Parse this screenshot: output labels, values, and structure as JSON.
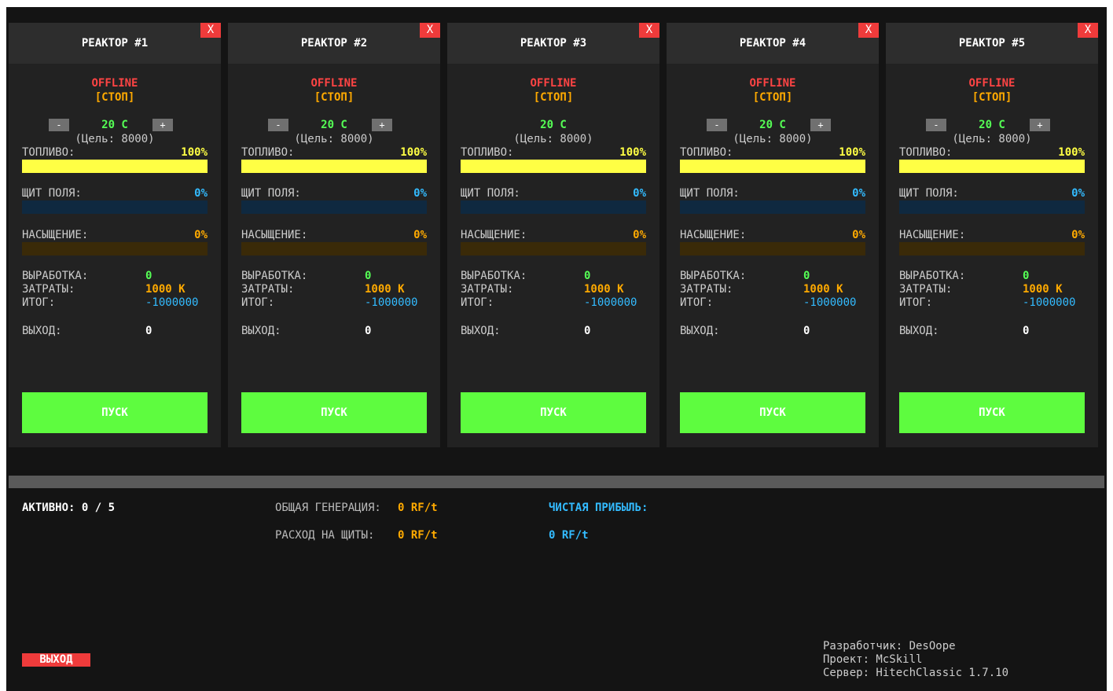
{
  "reactors": [
    {
      "title": "РЕАКТОР #1",
      "close": "X",
      "status": "OFFLINE",
      "state": "[СТОП]",
      "minus": "-",
      "temp": "20 C",
      "plus": "+",
      "target": "(Цель: 8000)",
      "fuel_label": "ТОПЛИВО:",
      "fuel_pct": "100%",
      "fuel_value": 1.0,
      "shield_label": "ЩИТ ПОЛЯ:",
      "shield_pct": "0%",
      "shield_value": 0,
      "sat_label": "НАСЫЩЕНИЕ:",
      "sat_pct": "0%",
      "sat_value": 0,
      "gen_label": "ВЫРАБОТКА:",
      "gen_value": "0",
      "cost_label": "ЗАТРАТЫ:",
      "cost_value": "1000 K",
      "total_label": "ИТОГ:",
      "total_value": "-1000000",
      "out_label": "ВЫХОД:",
      "out_value": "0",
      "start": "ПУСК"
    },
    {
      "title": "РЕАКТОР #2",
      "close": "X",
      "status": "OFFLINE",
      "state": "[СТОП]",
      "minus": "-",
      "temp": "20 C",
      "plus": "+",
      "target": "(Цель: 8000)",
      "fuel_label": "ТОПЛИВО:",
      "fuel_pct": "100%",
      "fuel_value": 1.0,
      "shield_label": "ЩИТ ПОЛЯ:",
      "shield_pct": "0%",
      "shield_value": 0,
      "sat_label": "НАСЫЩЕНИЕ:",
      "sat_pct": "0%",
      "sat_value": 0,
      "gen_label": "ВЫРАБОТКА:",
      "gen_value": "0",
      "cost_label": "ЗАТРАТЫ:",
      "cost_value": "1000 K",
      "total_label": "ИТОГ:",
      "total_value": "-1000000",
      "out_label": "ВЫХОД:",
      "out_value": "0",
      "start": "ПУСК"
    },
    {
      "title": "РЕАКТОР #3",
      "close": "X",
      "status": "OFFLINE",
      "state": "[СТОП]",
      "minus": "",
      "temp": "20 C",
      "plus": "",
      "target": "(Цель: 8000)",
      "fuel_label": "ТОПЛИВО:",
      "fuel_pct": "100%",
      "fuel_value": 1.0,
      "shield_label": "ЩИТ ПОЛЯ:",
      "shield_pct": "0%",
      "shield_value": 0,
      "sat_label": "НАСЫЩЕНИЕ:",
      "sat_pct": "0%",
      "sat_value": 0,
      "gen_label": "ВЫРАБОТКА:",
      "gen_value": "0",
      "cost_label": "ЗАТРАТЫ:",
      "cost_value": "1000 K",
      "total_label": "ИТОГ:",
      "total_value": "-1000000",
      "out_label": "ВЫХОД:",
      "out_value": "0",
      "start": "ПУСК"
    },
    {
      "title": "РЕАКТОР #4",
      "close": "X",
      "status": "OFFLINE",
      "state": "[СТОП]",
      "minus": "-",
      "temp": "20 C",
      "plus": "+",
      "target": "(Цель: 8000)",
      "fuel_label": "ТОПЛИВО:",
      "fuel_pct": "100%",
      "fuel_value": 1.0,
      "shield_label": "ЩИТ ПОЛЯ:",
      "shield_pct": "0%",
      "shield_value": 0,
      "sat_label": "НАСЫЩЕНИЕ:",
      "sat_pct": "0%",
      "sat_value": 0,
      "gen_label": "ВЫРАБОТКА:",
      "gen_value": "0",
      "cost_label": "ЗАТРАТЫ:",
      "cost_value": "1000 K",
      "total_label": "ИТОГ:",
      "total_value": "-1000000",
      "out_label": "ВЫХОД:",
      "out_value": "0",
      "start": "ПУСК"
    },
    {
      "title": "РЕАКТОР #5",
      "close": "X",
      "status": "OFFLINE",
      "state": "[СТОП]",
      "minus": "-",
      "temp": "20 C",
      "plus": "+",
      "target": "(Цель: 8000)",
      "fuel_label": "ТОПЛИВО:",
      "fuel_pct": "100%",
      "fuel_value": 1.0,
      "shield_label": "ЩИТ ПОЛЯ:",
      "shield_pct": "0%",
      "shield_value": 0,
      "sat_label": "НАСЫЩЕНИЕ:",
      "sat_pct": "0%",
      "sat_value": 0,
      "gen_label": "ВЫРАБОТКА:",
      "gen_value": "0",
      "cost_label": "ЗАТРАТЫ:",
      "cost_value": "1000 K",
      "total_label": "ИТОГ:",
      "total_value": "-1000000",
      "out_label": "ВЫХОД:",
      "out_value": "0",
      "start": "ПУСК"
    }
  ],
  "summary": {
    "active_label": "АКТИВНО: 0 / 5",
    "total_gen_label": "ОБЩАЯ ГЕНЕРАЦИЯ:",
    "total_gen_value": "0 RF/t",
    "shield_cost_label": "РАСХОД НА ЩИТЫ:",
    "shield_cost_value": "0 RF/t",
    "net_profit_label": "ЧИСТАЯ ПРИБЫЛЬ:",
    "net_profit_value": "0 RF/t",
    "exit_label": "ВЫХОД"
  },
  "credits": {
    "developer": "Разработчик: DesOope",
    "project": "Проект: McSkill",
    "server": "Сервер: HitechClassic 1.7.10"
  },
  "colors": {
    "fuel_bar": "#ffff44",
    "fuel_track": "#3a3a10",
    "shield_bar": "#1e90ff",
    "shield_track": "#0f2940",
    "sat_bar": "#ffaa00",
    "sat_track": "#3a2a08",
    "green": "#55ff55",
    "orange": "#ffaa00",
    "cyan": "#33bbff",
    "yellow": "#ffff44",
    "red": "#ff4444"
  }
}
